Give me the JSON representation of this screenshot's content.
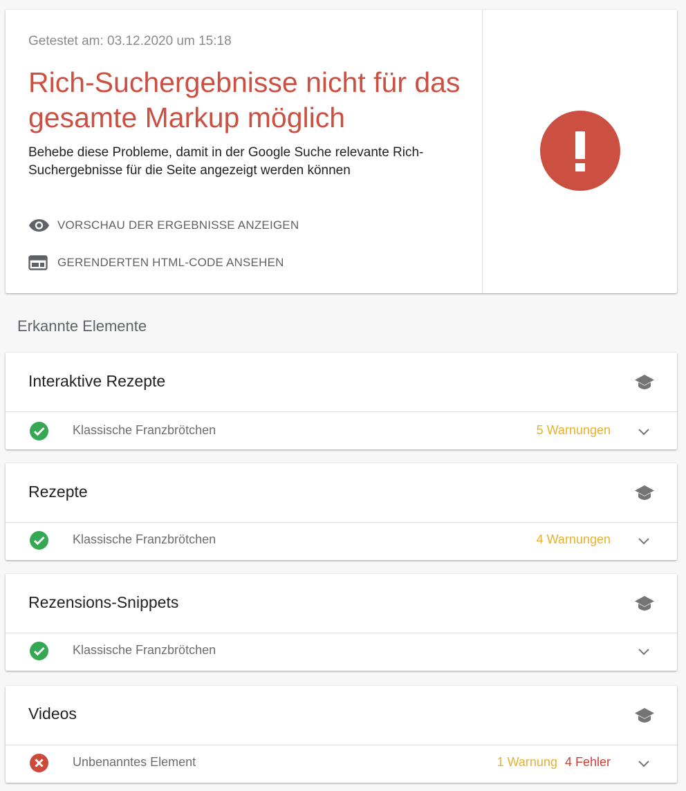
{
  "summary": {
    "tested_at": "Getestet am: 03.12.2020 um 15:18",
    "headline": "Rich-Suchergebnisse nicht für das gesamte Markup möglich",
    "description": "Behebe diese Probleme, damit in der Google Suche relevante Rich-Suchergebnisse für die Seite angezeigt werden können",
    "actions": [
      {
        "label": "VORSCHAU DER ERGEBNISSE ANZEIGEN",
        "icon": "eye-icon"
      },
      {
        "label": "GERENDERTEN HTML-CODE ANSEHEN",
        "icon": "html-code-icon"
      }
    ],
    "status_icon": "error-exclamation-icon"
  },
  "section_title": "Erkannte Elemente",
  "elements": [
    {
      "title": "Interaktive Rezepte",
      "item": "Klassische Franzbrötchen",
      "status": "valid",
      "warnings": "5 Warnungen",
      "errors": ""
    },
    {
      "title": "Rezepte",
      "item": "Klassische Franzbrötchen",
      "status": "valid",
      "warnings": "4 Warnungen",
      "errors": ""
    },
    {
      "title": "Rezensions-Snippets",
      "item": "Klassische Franzbrötchen",
      "status": "valid",
      "warnings": "",
      "errors": ""
    },
    {
      "title": "Videos",
      "item": "Unbenanntes Element",
      "status": "invalid",
      "warnings": "1 Warnung",
      "errors": "4 Fehler"
    }
  ],
  "colors": {
    "error": "#cc5041",
    "warning": "#e8b02e",
    "valid": "#34a853",
    "background": "#f7f7f7"
  }
}
